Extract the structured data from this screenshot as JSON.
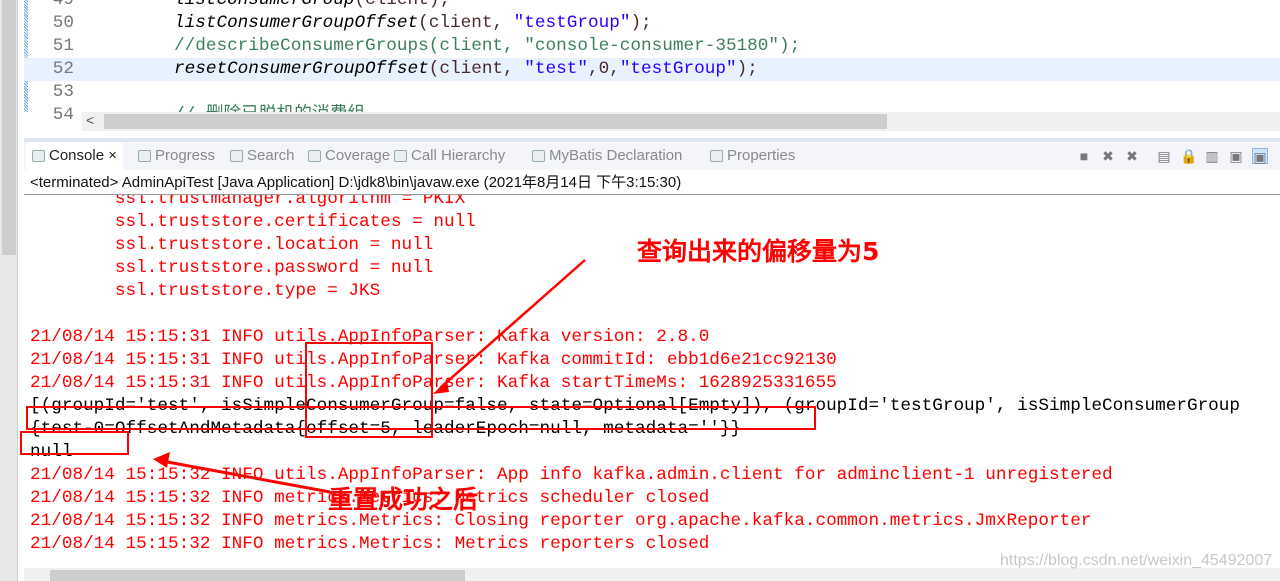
{
  "editor": {
    "lines": [
      {
        "num": "49",
        "parts": [
          {
            "t": "listConsumerGroup",
            "c": "fn"
          },
          {
            "t": "(client);",
            "c": "plain"
          }
        ]
      },
      {
        "num": "50",
        "parts": [
          {
            "t": "listConsumerGroupOffset",
            "c": "fn"
          },
          {
            "t": "(client, ",
            "c": "plain"
          },
          {
            "t": "\"testGroup\"",
            "c": "str"
          },
          {
            "t": ");",
            "c": "plain"
          }
        ]
      },
      {
        "num": "51",
        "parts": [
          {
            "t": "//describeConsumerGroups(client, \"console-consumer-35180\");",
            "c": "cmt"
          }
        ]
      },
      {
        "num": "52",
        "parts": [
          {
            "t": "resetConsumerGroupOffset",
            "c": "fn"
          },
          {
            "t": "(client, ",
            "c": "plain"
          },
          {
            "t": "\"test\"",
            "c": "str"
          },
          {
            "t": ",0,",
            "c": "plain"
          },
          {
            "t": "\"testGroup\"",
            "c": "str"
          },
          {
            "t": ");",
            "c": "plain"
          }
        ]
      },
      {
        "num": "53",
        "parts": []
      },
      {
        "num": "54",
        "parts": [
          {
            "t": "// 删除已脱机的消费组",
            "c": "cmt"
          }
        ]
      }
    ]
  },
  "tabs": [
    {
      "label": "Console",
      "icon": "console-icon",
      "active": true,
      "close": "✕"
    },
    {
      "label": "Progress",
      "icon": "progress-icon"
    },
    {
      "label": "Search",
      "icon": "search-icon"
    },
    {
      "label": "Coverage",
      "icon": "coverage-icon"
    },
    {
      "label": "Call Hierarchy",
      "icon": "call-hierarchy-icon"
    },
    {
      "label": "MyBatis Declaration",
      "icon": "mybatis-icon"
    },
    {
      "label": "Properties",
      "icon": "properties-icon"
    }
  ],
  "toolbar": [
    {
      "name": "terminate-icon",
      "glyph": "■"
    },
    {
      "name": "remove-launch-icon",
      "glyph": "✖"
    },
    {
      "name": "remove-all-terminated-icon",
      "glyph": "✖"
    },
    {
      "name": "clear-console-icon",
      "glyph": "▤"
    },
    {
      "name": "scroll-lock-icon",
      "glyph": "🔒"
    },
    {
      "name": "word-wrap-icon",
      "glyph": "▥"
    },
    {
      "name": "show-console-on-output-icon",
      "glyph": "▣"
    },
    {
      "name": "pin-console-icon",
      "glyph": "▣"
    }
  ],
  "status": "<terminated> AdminApiTest [Java Application] D:\\jdk8\\bin\\javaw.exe (2021年8月14日 下午3:15:30)",
  "console": [
    {
      "t": "        ssl.trustmanager.algorithm = PKIX",
      "c": "red"
    },
    {
      "t": "        ssl.truststore.certificates = null",
      "c": "red"
    },
    {
      "t": "        ssl.truststore.location = null",
      "c": "red"
    },
    {
      "t": "        ssl.truststore.password = null",
      "c": "red"
    },
    {
      "t": "        ssl.truststore.type = JKS",
      "c": "red"
    },
    {
      "t": "",
      "c": "red"
    },
    {
      "t": "21/08/14 15:15:31 INFO utils.AppInfoParser: Kafka version: 2.8.0",
      "c": "red"
    },
    {
      "t": "21/08/14 15:15:31 INFO utils.AppInfoParser: Kafka commitId: ebb1d6e21cc92130",
      "c": "red"
    },
    {
      "t": "21/08/14 15:15:31 INFO utils.AppInfoParser: Kafka startTimeMs: 1628925331655",
      "c": "red"
    },
    {
      "t": "[(groupId='test', isSimpleConsumerGroup=false, state=Optional[Empty]), (groupId='testGroup', isSimpleConsumerGroup",
      "c": "blk"
    },
    {
      "t": "{test-0=OffsetAndMetadata{offset=5, leaderEpoch=null, metadata=''}}",
      "c": "blk"
    },
    {
      "t": "null",
      "c": "blk"
    },
    {
      "t": "21/08/14 15:15:32 INFO utils.AppInfoParser: App info kafka.admin.client for adminclient-1 unregistered",
      "c": "red"
    },
    {
      "t": "21/08/14 15:15:32 INFO metrics.Metrics: Metrics scheduler closed",
      "c": "red"
    },
    {
      "t": "21/08/14 15:15:32 INFO metrics.Metrics: Closing reporter org.apache.kafka.common.metrics.JmxReporter",
      "c": "red"
    },
    {
      "t": "21/08/14 15:15:32 INFO metrics.Metrics: Metrics reporters closed",
      "c": "red"
    }
  ],
  "annotations": {
    "offset_note": "查询出来的偏移量为5",
    "reset_note": "重置成功之后",
    "color": "#ff0000"
  },
  "watermark": "https://blog.csdn.net/weixin_45492007"
}
